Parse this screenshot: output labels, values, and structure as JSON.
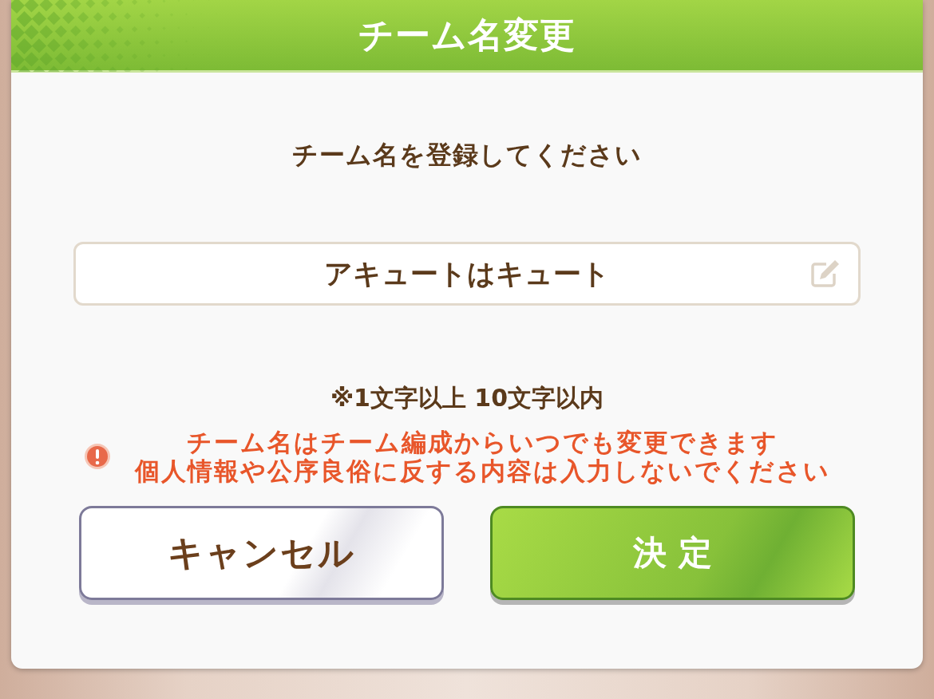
{
  "dialog": {
    "title": "チーム名変更",
    "prompt": "チーム名を登録してください",
    "name_field": {
      "value": "アキュートはキュート"
    },
    "rule": "※1文字以上 10文字以内",
    "warning": {
      "lines": [
        "チーム名はチーム編成からいつでも変更できます",
        "個人情報や公序良俗に反する内容は入力しないでください"
      ]
    },
    "buttons": [
      {
        "kind": "cancel",
        "label": "キャンセル"
      },
      {
        "kind": "confirm",
        "label": "決 定"
      }
    ]
  }
}
